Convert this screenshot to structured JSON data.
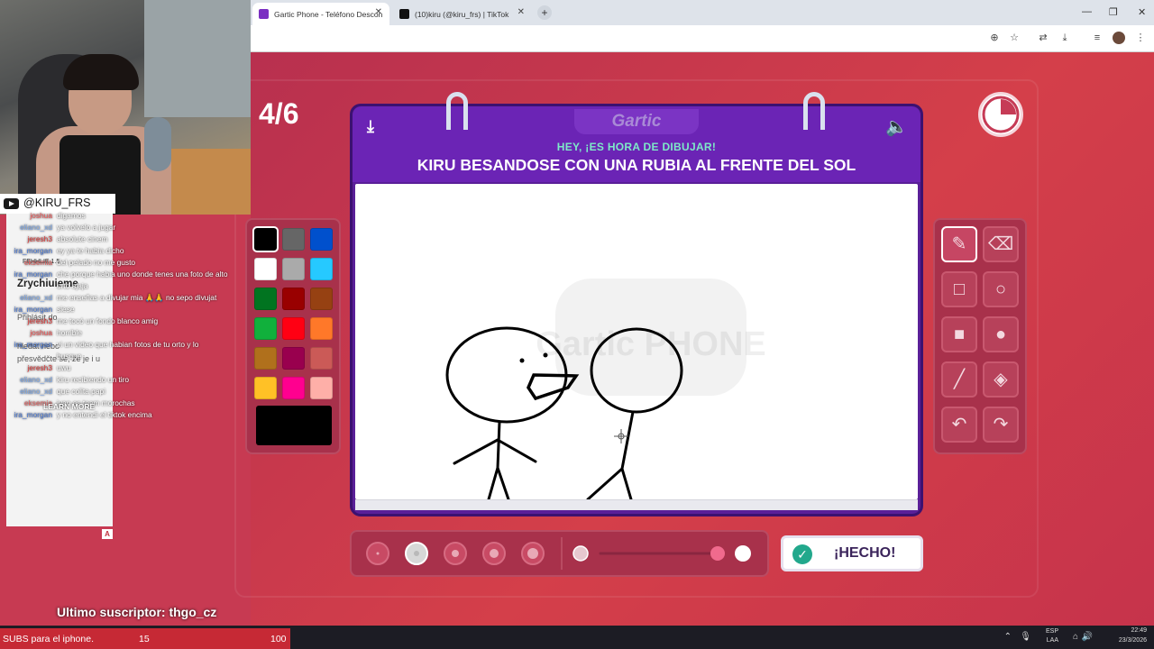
{
  "browser": {
    "tabs": [
      {
        "title": "Gartic Phone - Teléfono Descon",
        "active": true
      },
      {
        "title": "(10)kiru (@kiru_frs) | TikTok",
        "active": false
      }
    ],
    "new_tab_symbol": "+",
    "window_buttons": [
      "—",
      "❐",
      "✕"
    ]
  },
  "overlay": {
    "handle": "@KIRU_FRS",
    "learn_more": "LEARN MORE",
    "last_sub": "Ultimo suscriptor: thgo_cz",
    "chat_badge": "A",
    "chat": [
      {
        "user": "joshua",
        "text": "digamos"
      },
      {
        "user": "eliano_xd",
        "text": "ya volvelo a jugar"
      },
      {
        "user": "jeresh3",
        "text": "absolute cinem"
      },
      {
        "user": "ira_morgan",
        "text": "ey ya te habia dicho"
      },
      {
        "user": "eksemia",
        "text": "del pelado no me gusto"
      },
      {
        "user": "ira_morgan",
        "text": "che porque habia uno donde tenes una foto de alto"
      },
      {
        "user": "",
        "text": "orto ajaja"
      },
      {
        "user": "eliano_xd",
        "text": "me enseñas a divujar mia 🙏🙏 no sepo divujat"
      },
      {
        "user": "ira_morgan",
        "text": "siese"
      },
      {
        "user": "jeresh3",
        "text": "me tocó un fondo blanco amig"
      },
      {
        "user": "joshua",
        "text": "horrible"
      },
      {
        "user": "ira_morgan",
        "text": "vi un video que habian fotos de tu orto y lo"
      },
      {
        "user": "",
        "text": "busque"
      },
      {
        "user": "jeresh3",
        "text": "uwu"
      },
      {
        "user": "eliano_xd",
        "text": "kiru recibiendo un tiro"
      },
      {
        "user": "eliano_xd",
        "text": "que colita papi"
      },
      {
        "user": "eksemia",
        "text": "ivan es team morochas"
      },
      {
        "user": "ira_morgan",
        "text": "y no entendi el tiktok encima"
      }
    ],
    "ghost_text": [
      "FEHHLIE 1.5",
      "Zrychiuieme",
      "Přihlásit do",
      "hledat nebo",
      "přesvědčte se, že je i u"
    ],
    "goal": {
      "label": "SUBS para el iphone.",
      "current": "15",
      "target": "100"
    }
  },
  "tray": {
    "lang": "ESP",
    "lang2": "LAA",
    "time": "22:49",
    "date": "23/3/2026"
  },
  "game": {
    "round": "4/6",
    "logo": "Gartic",
    "watermark": "Gartic PHONE",
    "heading": "HEY, ¡ES HORA DE DIBUJAR!",
    "prompt": "KIRU BESANDOSE CON UNA RUBIA AL FRENTE DEL SOL",
    "done_label": "¡HECHO!",
    "timer_elapsed_fraction": 0.75,
    "palette": [
      [
        "#000000",
        "#666666",
        "#0050cd"
      ],
      [
        "#ffffff",
        "#aaaaaa",
        "#26c9ff"
      ],
      [
        "#017420",
        "#990000",
        "#964112"
      ],
      [
        "#11b03c",
        "#ff0013",
        "#ff7829"
      ],
      [
        "#b0701c",
        "#99004e",
        "#cb5a57"
      ],
      [
        "#ffc126",
        "#ff008f",
        "#feafa8"
      ]
    ],
    "current_color": "#000000",
    "tools": [
      {
        "name": "pencil",
        "glyph": "✎",
        "selected": true
      },
      {
        "name": "eraser",
        "glyph": "⌫",
        "selected": false
      },
      {
        "name": "rectangle",
        "glyph": "□",
        "selected": false
      },
      {
        "name": "ellipse",
        "glyph": "○",
        "selected": false
      },
      {
        "name": "filled-rectangle",
        "glyph": "■",
        "selected": false
      },
      {
        "name": "filled-ellipse",
        "glyph": "●",
        "selected": false
      },
      {
        "name": "line",
        "glyph": "╱",
        "selected": false
      },
      {
        "name": "bucket",
        "glyph": "◈",
        "selected": false
      },
      {
        "name": "undo",
        "glyph": "↶",
        "selected": false
      },
      {
        "name": "redo",
        "glyph": "↷",
        "selected": false
      }
    ],
    "brush_sizes_selected_index": 1,
    "opacity_fraction": 1.0
  }
}
